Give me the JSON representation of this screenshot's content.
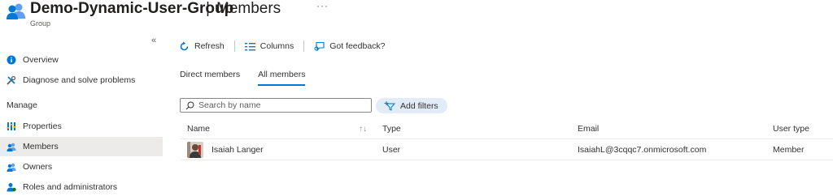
{
  "header": {
    "title": "Demo-Dynamic-User-Group",
    "separator": "|",
    "section": "Members",
    "more": "···",
    "subtitle": "Group",
    "icon": "group-icon"
  },
  "sidebar": {
    "collapse": "«",
    "items": [
      {
        "label": "Overview",
        "icon": "info-icon"
      },
      {
        "label": "Diagnose and solve problems",
        "icon": "wrench-icon"
      },
      {
        "label": "Properties",
        "icon": "properties-icon"
      },
      {
        "label": "Members",
        "icon": "members-icon"
      },
      {
        "label": "Owners",
        "icon": "owners-icon"
      },
      {
        "label": "Roles and administrators",
        "icon": "roles-icon"
      }
    ],
    "section_manage": "Manage"
  },
  "toolbar": {
    "refresh": "Refresh",
    "columns": "Columns",
    "feedback": "Got feedback?"
  },
  "tabs": [
    {
      "label": "Direct members",
      "active": false
    },
    {
      "label": "All members",
      "active": true
    }
  ],
  "search": {
    "placeholder": "Search by name"
  },
  "filters": {
    "label": "Add filters"
  },
  "table": {
    "headers": {
      "name": "Name",
      "sort": "↑↓",
      "type": "Type",
      "email": "Email",
      "user_type": "User type"
    },
    "rows": [
      {
        "name": "Isaiah Langer",
        "type": "User",
        "email": "IsaiahL@3cqqc7.onmicrosoft.com",
        "user_type": "Member"
      }
    ]
  },
  "colors": {
    "accent": "#0078d4",
    "selected_bg": "#edebe9",
    "chip_bg": "#e1ecf8"
  }
}
